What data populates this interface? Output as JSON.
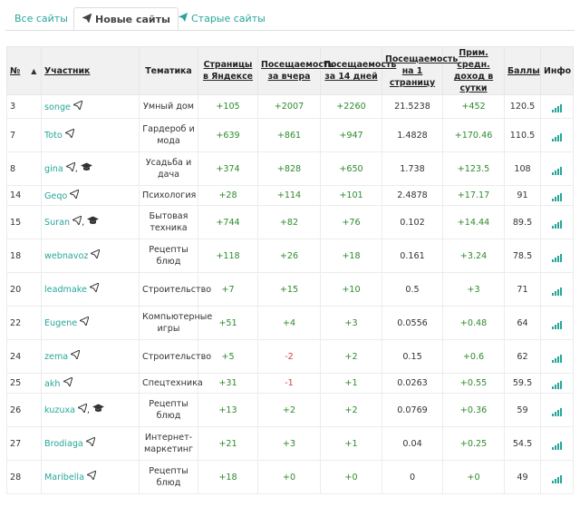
{
  "tabs": [
    {
      "label": "Все сайты",
      "icon": "",
      "active": false
    },
    {
      "label": "Новые сайты",
      "icon": "paper-plane-icon",
      "active": true
    },
    {
      "label": "Старые сайты",
      "icon": "paper-plane-icon",
      "active": false
    }
  ],
  "table": {
    "headers": {
      "num": "№",
      "user": "Участник",
      "theme": "Тематика",
      "pages": "Страницы в Яндексе",
      "visits_yesterday": "Посещаемость за вчера",
      "visits_14": "Посещаемость за 14 дней",
      "per_page": "Посещаемость на 1 страницу",
      "income": "Прим. средн. доход в сутки",
      "score": "Баллы",
      "info": "Инфо"
    },
    "rows": [
      {
        "num": "3",
        "user": "songe",
        "grad": false,
        "theme": "Умный дом",
        "pages": "+105",
        "v1": "+2007",
        "v14": "+2260",
        "per": "21.5238",
        "income": "+452",
        "score": "120.5"
      },
      {
        "num": "7",
        "user": "Toto",
        "grad": false,
        "theme": "Гардероб и мода",
        "pages": "+639",
        "v1": "+861",
        "v14": "+947",
        "per": "1.4828",
        "income": "+170.46",
        "score": "110.5"
      },
      {
        "num": "8",
        "user": "gina",
        "grad": true,
        "theme": "Усадьба и дача",
        "pages": "+374",
        "v1": "+828",
        "v14": "+650",
        "per": "1.738",
        "income": "+123.5",
        "score": "108"
      },
      {
        "num": "14",
        "user": "Geqo",
        "grad": false,
        "theme": "Психология",
        "pages": "+28",
        "v1": "+114",
        "v14": "+101",
        "per": "2.4878",
        "income": "+17.17",
        "score": "91"
      },
      {
        "num": "15",
        "user": "Suran",
        "grad": true,
        "theme": "Бытовая техника",
        "pages": "+744",
        "v1": "+82",
        "v14": "+76",
        "per": "0.102",
        "income": "+14.44",
        "score": "89.5"
      },
      {
        "num": "18",
        "user": "webnavoz",
        "grad": false,
        "theme": "Рецепты блюд",
        "pages": "+118",
        "v1": "+26",
        "v14": "+18",
        "per": "0.161",
        "income": "+3.24",
        "score": "78.5"
      },
      {
        "num": "20",
        "user": "leadmake",
        "grad": false,
        "theme": "Строительство",
        "pages": "+7",
        "v1": "+15",
        "v14": "+10",
        "per": "0.5",
        "income": "+3",
        "score": "71"
      },
      {
        "num": "22",
        "user": "Eugene",
        "grad": false,
        "theme": "Компьютерные игры",
        "pages": "+51",
        "v1": "+4",
        "v14": "+3",
        "per": "0.0556",
        "income": "+0.48",
        "score": "64"
      },
      {
        "num": "24",
        "user": "zema",
        "grad": false,
        "theme": "Строительство",
        "pages": "+5",
        "v1": "-2",
        "v14": "+2",
        "per": "0.15",
        "income": "+0.6",
        "score": "62"
      },
      {
        "num": "25",
        "user": "akh",
        "grad": false,
        "theme": "Спецтехника",
        "pages": "+31",
        "v1": "-1",
        "v14": "+1",
        "per": "0.0263",
        "income": "+0.55",
        "score": "59.5"
      },
      {
        "num": "26",
        "user": "kuzuxa",
        "grad": true,
        "theme": "Рецепты блюд",
        "pages": "+13",
        "v1": "+2",
        "v14": "+2",
        "per": "0.0769",
        "income": "+0.36",
        "score": "59"
      },
      {
        "num": "27",
        "user": "Brodiaga",
        "grad": false,
        "theme": "Интернет-маркетинг",
        "pages": "+21",
        "v1": "+3",
        "v14": "+1",
        "per": "0.04",
        "income": "+0.25",
        "score": "54.5"
      },
      {
        "num": "28",
        "user": "Maribella",
        "grad": false,
        "theme": "Рецепты блюд",
        "pages": "+18",
        "v1": "+0",
        "v14": "+0",
        "per": "0",
        "income": "+0",
        "score": "49"
      }
    ]
  },
  "colors": {
    "accent": "#26a69a",
    "positive": "#2e8b2e",
    "negative": "#d43c3c"
  }
}
